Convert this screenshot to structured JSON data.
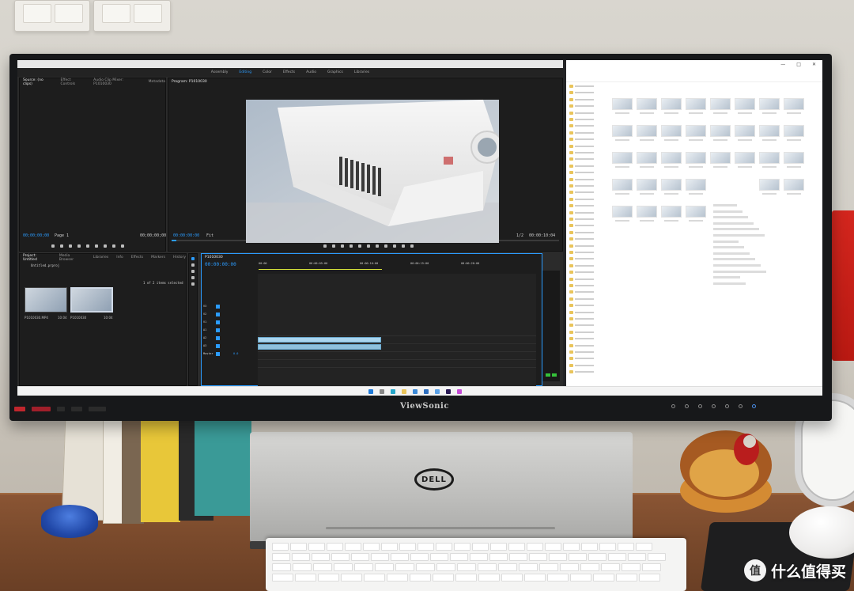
{
  "scene": {
    "monitor_brand": "ViewSonic",
    "laptop_brand": "DELL"
  },
  "premiere": {
    "workspaces": [
      "Assembly",
      "Editing",
      "Color",
      "Effects",
      "Audio",
      "Graphics",
      "Libraries"
    ],
    "active_workspace": "Editing",
    "source_tabs": [
      "Source: (no clips)",
      "Effect Controls",
      "Audio Clip Mixer: P1010030",
      "Metadata"
    ],
    "program_tab": "Program: P1010030",
    "source_timecode_left": "00;00;00;00",
    "source_page": "Page 1",
    "source_timecode_right": "00;00;00;00",
    "program_timecode_left": "00:00:00:00",
    "program_fit": "Fit",
    "program_zoom": "1/2",
    "program_timecode_right": "00:00:10:04",
    "project_tabs": [
      "Project: Untitled",
      "Media Browser",
      "Libraries",
      "Info",
      "Effects",
      "Markers",
      "History"
    ],
    "project_file": "Untitled.prproj",
    "items_selected": "1 of 2 items selected",
    "clips": [
      {
        "name": "P1010030.MP4",
        "duration": "10:04"
      },
      {
        "name": "P1010030",
        "duration": "10:04"
      }
    ],
    "sequence_tab": "P1010030",
    "sequence_timecode": "00:00:00:00",
    "ruler": [
      "00:00",
      "00:00:05:00",
      "00:00:10:00",
      "00:00:15:00",
      "00:00:20:00"
    ],
    "tracks": [
      "V3",
      "V2",
      "V1",
      "A1",
      "A2",
      "A3",
      "Master"
    ],
    "master_value": "0.0"
  },
  "explorer": {
    "close_glyph": "✕",
    "maximize_glyph": "□",
    "minimize_glyph": "—"
  },
  "watermark": {
    "badge": "值",
    "text": "什么值得买"
  },
  "colors": {
    "premiere_accent": "#2b9cff",
    "clip_color": "#a9d5ee",
    "folder_yellow": "#e9c45a"
  }
}
